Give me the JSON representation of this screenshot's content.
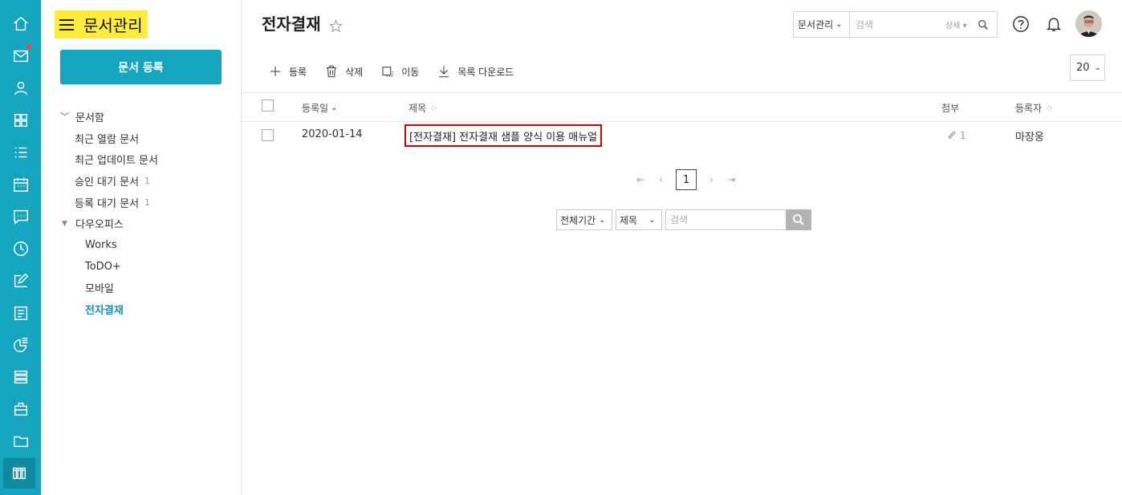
{
  "app": {
    "title": "문서관리"
  },
  "rail": {
    "items": [
      "home-icon",
      "mail-icon",
      "contact-icon",
      "apps-icon",
      "list-icon",
      "calendar-icon",
      "chat-icon",
      "clock-icon",
      "edit-icon",
      "board-icon",
      "report-icon",
      "stack-icon",
      "briefcase-icon",
      "folder-icon",
      "doc-library-icon"
    ]
  },
  "sidebar": {
    "register_label": "문서 등록",
    "tree": {
      "root_label": "문서함",
      "items": [
        {
          "label": "최근 열람 문서",
          "count": ""
        },
        {
          "label": "최근 업데이트 문서",
          "count": ""
        },
        {
          "label": "승인 대기 문서",
          "count": "1"
        },
        {
          "label": "등록 대기 문서",
          "count": "1"
        }
      ],
      "group_label": "다우오피스",
      "children": [
        "Works",
        "ToDO+",
        "모바일",
        "전자결재"
      ],
      "selected": "전자결재"
    }
  },
  "header": {
    "title": "전자결재",
    "search_scope": "문서관리",
    "search_placeholder": "검색",
    "search_detail": "상세"
  },
  "toolbar": {
    "add_label": "등록",
    "delete_label": "삭제",
    "move_label": "이동",
    "download_label": "목록 다운로드",
    "page_size": "20"
  },
  "table": {
    "headers": {
      "date": "등록일",
      "title": "제목",
      "attach": "첨부",
      "author": "등록자"
    },
    "rows": [
      {
        "date": "2020-01-14",
        "title": "[전자결재] 전자결재 샘플 양식 이용 매뉴얼",
        "attach_count": "1",
        "author": "마장웅"
      }
    ]
  },
  "pagination": {
    "current": "1"
  },
  "bottom_search": {
    "period": "전체기간",
    "field": "제목",
    "placeholder": "검색"
  },
  "colors": {
    "accent": "#16a5bf",
    "highlight": "#ffeb3b",
    "box": "#d40000"
  }
}
